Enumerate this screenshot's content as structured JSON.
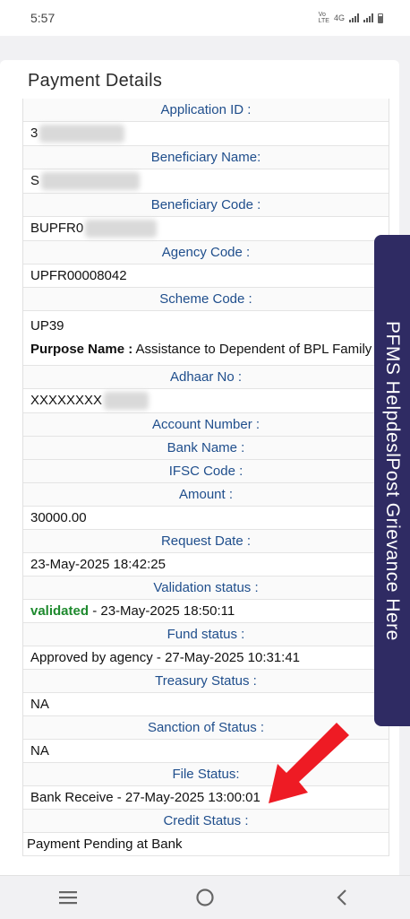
{
  "status_bar": {
    "time": "5:57",
    "network": "4G"
  },
  "page_title": "Payment Details",
  "fields": {
    "application_id_label": "Application ID :",
    "application_id_value": "3",
    "beneficiary_name_label": "Beneficiary Name:",
    "beneficiary_name_value": "S",
    "beneficiary_code_label": "Beneficiary Code :",
    "beneficiary_code_value": "BUPFR0",
    "agency_code_label": "Agency Code :",
    "agency_code_value": "UPFR00008042",
    "scheme_code_label": "Scheme Code :",
    "scheme_code_value": "UP39",
    "purpose_name_label": "Purpose Name :",
    "purpose_name_value": " Assistance to Dependent of BPL Family",
    "adhaar_label": "Adhaar No :",
    "adhaar_value": "XXXXXXXX",
    "account_number_label": "Account Number :",
    "bank_name_label": "Bank Name :",
    "ifsc_label": "IFSC Code :",
    "amount_label": "Amount :",
    "amount_value": "30000.00",
    "request_date_label": "Request Date :",
    "request_date_value": "23-May-2025 18:42:25",
    "validation_status_label": "Validation status :",
    "validation_status_word": "validated",
    "validation_status_rest": " - 23-May-2025 18:50:11",
    "fund_status_label": "Fund status :",
    "fund_status_value": "Approved by agency - 27-May-2025 10:31:41",
    "treasury_status_label": "Treasury Status :",
    "treasury_status_value": "NA",
    "sanction_status_label": "Sanction of Status :",
    "sanction_status_value": "NA",
    "file_status_label": "File Status:",
    "file_status_value": "Bank Receive - 27-May-2025 13:00:01",
    "credit_status_label": "Credit Status :",
    "credit_status_value": "Payment Pending at Bank"
  },
  "side_tab": {
    "part1": "PFMS Helpdesl",
    "part2": "Post Grievance Here"
  },
  "colors": {
    "header_text": "#1f4e8c",
    "validated": "#1e8a2e",
    "side_tab": "#2f2b63",
    "arrow": "#ee1b24"
  },
  "nav_icons": [
    "recent-apps-icon",
    "home-icon",
    "back-icon"
  ]
}
